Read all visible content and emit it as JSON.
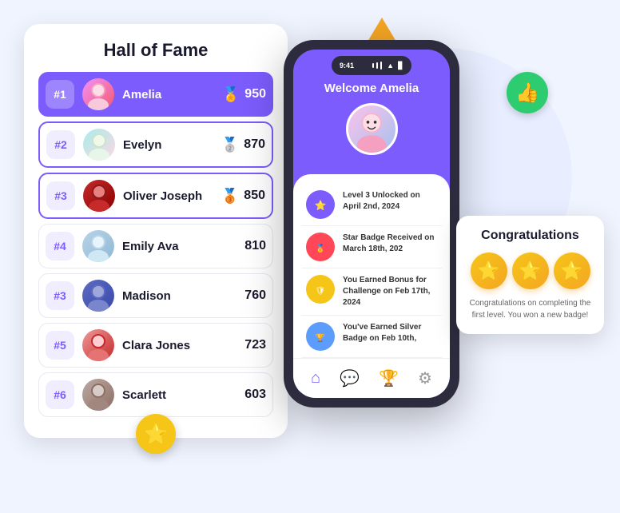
{
  "hof": {
    "title": "Hall of Fame",
    "rows": [
      {
        "rank": "#1",
        "name": "Amelia",
        "score": "950",
        "medal": "🏅",
        "highlight": true,
        "bordered": false,
        "avatar_class": "avatar-1",
        "avatar_emoji": "👩"
      },
      {
        "rank": "#2",
        "name": "Evelyn",
        "score": "870",
        "medal": "🥈",
        "highlight": false,
        "bordered": true,
        "avatar_class": "avatar-2",
        "avatar_emoji": "👩"
      },
      {
        "rank": "#3",
        "name": "Oliver Joseph",
        "score": "850",
        "medal": "🥉",
        "highlight": false,
        "bordered": true,
        "avatar_class": "avatar-3",
        "avatar_emoji": "👩"
      },
      {
        "rank": "#4",
        "name": "Emily Ava",
        "score": "810",
        "medal": "",
        "highlight": false,
        "bordered": false,
        "avatar_class": "avatar-4",
        "avatar_emoji": "👩"
      },
      {
        "rank": "#3",
        "name": "Madison",
        "score": "760",
        "medal": "",
        "highlight": false,
        "bordered": false,
        "avatar_class": "avatar-5",
        "avatar_emoji": "👩"
      },
      {
        "rank": "#5",
        "name": "Clara Jones",
        "score": "723",
        "medal": "",
        "highlight": false,
        "bordered": false,
        "avatar_class": "avatar-6",
        "avatar_emoji": "👩"
      },
      {
        "rank": "#6",
        "name": "Scarlett",
        "score": "603",
        "medal": "",
        "highlight": false,
        "bordered": false,
        "avatar_class": "avatar-7",
        "avatar_emoji": "👩"
      }
    ]
  },
  "phone": {
    "status_time": "9:41",
    "welcome": "Welcome Amelia",
    "activities": [
      {
        "text": "Level 3 Unlocked on April 2nd, 2024",
        "icon": "⭐",
        "icon_class": "activity-icon-purple"
      },
      {
        "text": "Star Badge Received on March 18th, 202",
        "icon": "🏅",
        "icon_class": "activity-icon-red"
      },
      {
        "text": "You Earned Bonus for Challenge on Feb 17th, 2024",
        "icon": "🛡",
        "icon_class": "activity-icon-gold"
      },
      {
        "text": "You've Earned Silver Badge on Feb 10th,",
        "icon": "🏆",
        "icon_class": "activity-icon-blue"
      }
    ]
  },
  "congrats": {
    "title": "Congratulations",
    "text": "Congratulations on completing the first level. You won a new badge!",
    "stars": [
      "⭐",
      "⭐",
      "⭐"
    ]
  },
  "decorations": {
    "thumbs_up": "👍",
    "star": "⭐",
    "triangle_color": "#f5a623"
  }
}
